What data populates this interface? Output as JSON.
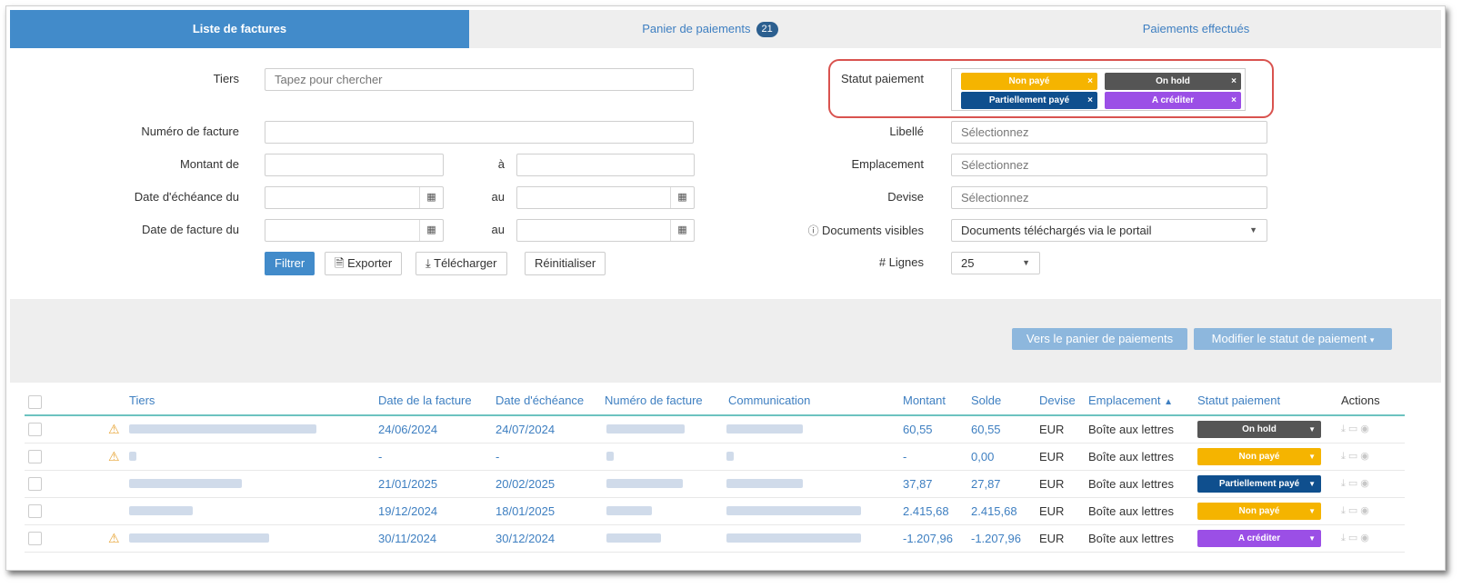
{
  "tabs": [
    {
      "label": "Liste de factures"
    },
    {
      "label": "Panier de paiements",
      "badge": "21"
    },
    {
      "label": "Paiements effectués"
    }
  ],
  "filters": {
    "tiers_label": "Tiers",
    "tiers_placeholder": "Tapez pour chercher",
    "numero_label": "Numéro de facture",
    "montant_label": "Montant de",
    "a_label": "à",
    "echeance_label": "Date d'échéance du",
    "facture_label": "Date de facture du",
    "au_label": "au",
    "filtrer": "Filtrer",
    "exporter": "Exporter",
    "telecharger": "Télécharger",
    "reinitialiser": "Réinitialiser",
    "statut_label": "Statut paiement",
    "statut_chips": [
      {
        "label": "Non payé",
        "color": "#f5b400"
      },
      {
        "label": "On hold",
        "color": "#555555"
      },
      {
        "label": "Partiellement payé",
        "color": "#0f4f8e"
      },
      {
        "label": "A créditer",
        "color": "#9b4fe6"
      }
    ],
    "libelle_label": "Libellé",
    "libelle_placeholder": "Sélectionnez",
    "emplacement_label": "Emplacement",
    "emplacement_placeholder": "Sélectionnez",
    "devise_label": "Devise",
    "devise_placeholder": "Sélectionnez",
    "docs_label": "Documents visibles",
    "docs_value": "Documents téléchargés via le portail",
    "lignes_label": "# Lignes",
    "lignes_value": "25"
  },
  "bulk": {
    "panier_button": "Vers le panier de paiements",
    "modifier_button": "Modifier le statut de paiement"
  },
  "table": {
    "headers": {
      "tiers": "Tiers",
      "date_facture": "Date de la facture",
      "date_echeance": "Date d'échéance",
      "numero": "Numéro de facture",
      "communication": "Communication",
      "montant": "Montant",
      "solde": "Solde",
      "devise": "Devise",
      "emplacement": "Emplacement",
      "statut": "Statut paiement",
      "actions": "Actions"
    },
    "rows": [
      {
        "date_facture": "24/06/2024",
        "date_echeance": "24/07/2024",
        "montant": "60,55",
        "solde": "60,55",
        "devise": "EUR",
        "emplacement": "Boîte aux lettres",
        "statut": "On hold",
        "statut_color": "#555555"
      },
      {
        "date_facture": "-",
        "date_echeance": "-",
        "montant": "-",
        "solde": "0,00",
        "devise": "EUR",
        "emplacement": "Boîte aux lettres",
        "statut": "Non payé",
        "statut_color": "#f5b400"
      },
      {
        "date_facture": "21/01/2025",
        "date_echeance": "20/02/2025",
        "montant": "37,87",
        "solde": "27,87",
        "devise": "EUR",
        "emplacement": "Boîte aux lettres",
        "statut": "Partiellement payé",
        "statut_color": "#0f4f8e"
      },
      {
        "date_facture": "19/12/2024",
        "date_echeance": "18/01/2025",
        "montant": "2.415,68",
        "solde": "2.415,68",
        "devise": "EUR",
        "emplacement": "Boîte aux lettres",
        "statut": "Non payé",
        "statut_color": "#f5b400"
      },
      {
        "date_facture": "30/11/2024",
        "date_echeance": "30/12/2024",
        "montant": "-1.207,96",
        "solde": "-1.207,96",
        "devise": "EUR",
        "emplacement": "Boîte aux lettres",
        "statut": "A créditer",
        "statut_color": "#9b4fe6"
      }
    ]
  }
}
